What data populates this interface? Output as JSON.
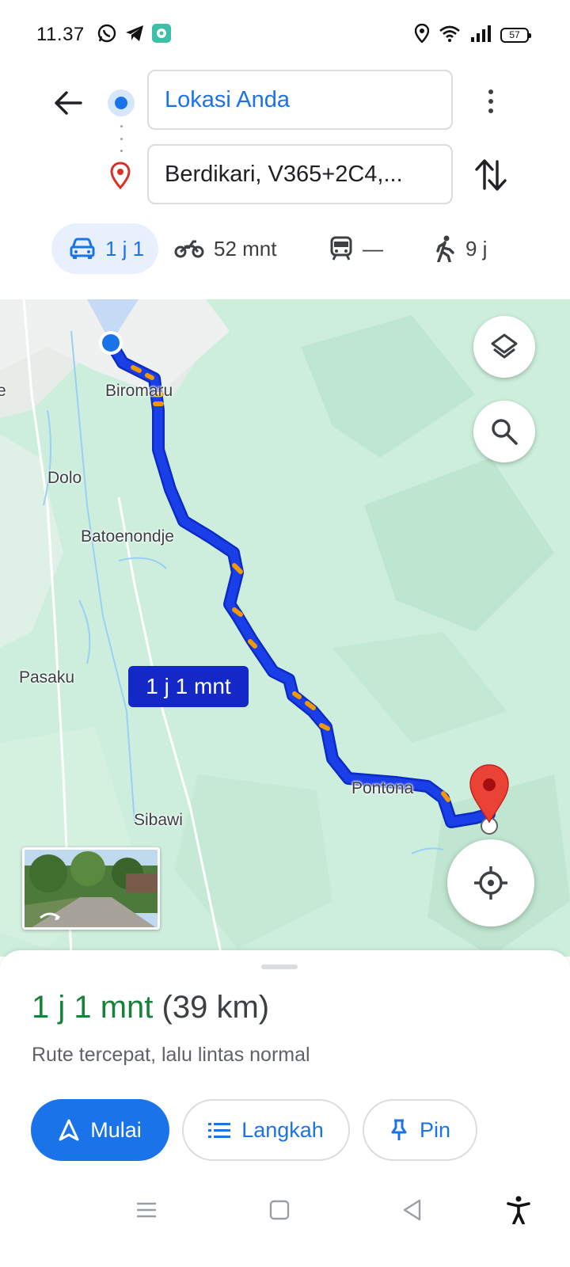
{
  "status_bar": {
    "time": "11.37",
    "battery": "57",
    "app_icons": [
      "whatsapp-icon",
      "telegram-icon",
      "app-icon"
    ],
    "system_icons": [
      "location-icon",
      "wifi-icon",
      "signal-icon",
      "battery-icon"
    ]
  },
  "search": {
    "origin": "Lokasi Anda",
    "destination": "Berdikari, V365+2C4,..."
  },
  "modes": [
    {
      "icon": "car-icon",
      "label": "1 j 1",
      "active": true
    },
    {
      "icon": "motorcycle-icon",
      "label": "52 mnt",
      "active": false
    },
    {
      "icon": "transit-icon",
      "label": "—",
      "active": false
    },
    {
      "icon": "walk-icon",
      "label": "9 j",
      "active": false
    }
  ],
  "map": {
    "labels": [
      "Biromaru",
      "Dolo",
      "Batoenondje",
      "Pasaku",
      "Pontona",
      "Sibawi",
      "e"
    ],
    "eta_bubble": "1 j 1 mnt",
    "colors": {
      "route": "#1a3ee8",
      "traffic": "#f29900",
      "land": "#cdeedd",
      "pin": "#ea4335"
    }
  },
  "route": {
    "duration": "1 j 1 mnt",
    "distance": "(39 km)",
    "note": "Rute tercepat, lalu lintas normal"
  },
  "actions": {
    "start": "Mulai",
    "steps": "Langkah",
    "pin": "Pin"
  },
  "colors": {
    "accent": "#1a73e8",
    "duration_green": "#188038"
  }
}
